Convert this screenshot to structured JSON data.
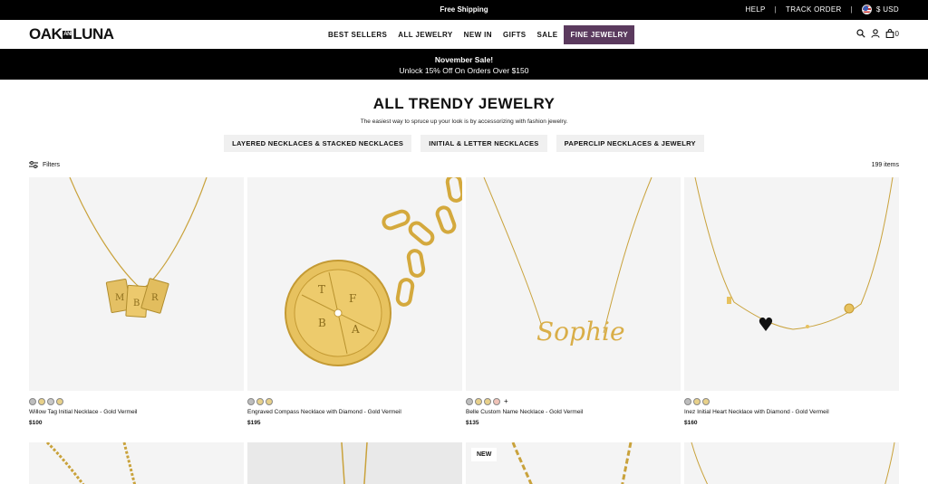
{
  "topbar": {
    "shipping": "Free Shipping",
    "help": "HELP",
    "separator": "|",
    "track": "TRACK ORDER",
    "currency": "$ USD"
  },
  "header": {
    "logo_left": "OAK",
    "logo_mid": "AND",
    "logo_right": "LUNA",
    "nav": [
      "BEST SELLERS",
      "ALL JEWELRY",
      "NEW IN",
      "GIFTS",
      "SALE",
      "FINE JEWELRY"
    ],
    "cart_count": "0",
    "icons": [
      "search-icon",
      "account-icon",
      "bag-icon"
    ]
  },
  "sale": {
    "title": "November Sale!",
    "text": "Unlock 15% Off On Orders Over $150"
  },
  "page": {
    "title": "ALL TRENDY JEWELRY",
    "subtitle": "The easiest way to spruce up your look is by accessorizing with fashion jewelry.",
    "pills": [
      "LAYERED NECKLACES & STACKED NECKLACES",
      "INITIAL & LETTER NECKLACES",
      "PAPERCLIP NECKLACES & JEWELRY"
    ],
    "filters": "Filters",
    "count": "199 items"
  },
  "colors": {
    "accent_fine": "#5b3a5e",
    "gold": "#e8d18a",
    "silver": "#c8c8c8",
    "rose": "#f0c3b8",
    "image_bg": "#f4f4f4"
  },
  "products": [
    {
      "name": "Willow Tag Initial Necklace - Gold Vermeil",
      "price": "$100",
      "swatches": [
        "#bdbdbd",
        "#e8d18a",
        "#c8c8c8",
        "#e8d18a"
      ],
      "more": ""
    },
    {
      "name": "Engraved Compass Necklace with Diamond - Gold Vermeil",
      "price": "$195",
      "swatches": [
        "#bdbdbd",
        "#e8d18a",
        "#e8d18a"
      ],
      "more": ""
    },
    {
      "name": "Belle Custom Name Necklace - Gold Vermeil",
      "price": "$135",
      "swatches": [
        "#bdbdbd",
        "#e8d18a",
        "#e8d18a",
        "#f0c3b8"
      ],
      "more": "+"
    },
    {
      "name": "Inez Initial Heart Necklace with Diamond - Gold Vermeil",
      "price": "$160",
      "swatches": [
        "#bdbdbd",
        "#e8d18a",
        "#e8d18a"
      ],
      "more": ""
    }
  ],
  "product_images": {
    "tag_letters": [
      "M",
      "B",
      "R"
    ],
    "compass_letters": [
      "T",
      "F",
      "A",
      "B"
    ],
    "script_name": "Sophie"
  },
  "row2": {
    "badge": "NEW"
  }
}
